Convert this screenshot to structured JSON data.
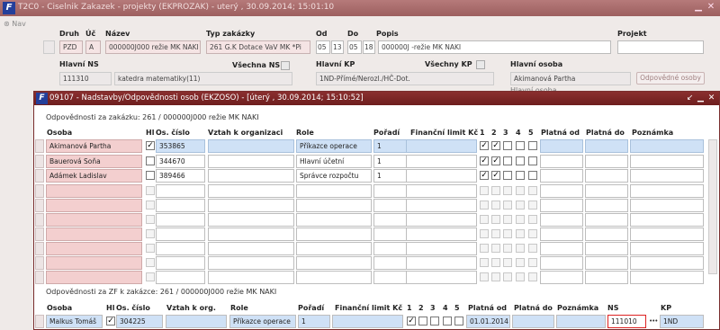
{
  "back_window": {
    "title": "T2C0 - Ciselnik Zakazek - projekty (EKPROZAK) - uterý , 30.09.2014; 15:01:10",
    "logo": "F",
    "nav_label": "Nav",
    "labels": {
      "druh": "Druh",
      "uc": "Úč",
      "nazev": "Název",
      "typ": "Typ zakázky",
      "od": "Od",
      "do": "Do",
      "popis": "Popis",
      "projekt": "Projekt",
      "hlavni_ns": "Hlavní NS",
      "vsechna_ns": "Všechna NS",
      "hlavni_kp": "Hlavní KP",
      "vsechny_kp": "Všechny KP",
      "hlavni_osoba": "Hlavní osoba"
    },
    "values": {
      "druh": "PZD",
      "uc": "A",
      "nazev": "000000J000 režie MK NAKI",
      "typ": "261 G.K Dotace VaV MK *Pi",
      "od_1": "05",
      "od_2": "13",
      "do_1": "05",
      "do_2": "18",
      "popis": "000000J -režie MK NAKI",
      "projekt": "",
      "ns_code": "111310",
      "ns_name": "katedra matematiky(11)",
      "kp": "1ND-Přímé/Nerozl./HČ-Dot.",
      "osoba": "Akimanová Partha"
    },
    "btn_odpovedne": "Odpovědné osoby",
    "cut_label": "Hlavní osoba"
  },
  "front_window": {
    "title": "09107 - Nadstavby/Odpovědnosti osob (EKZOSO) - [úterý , 30.09.2014; 15:10:52]",
    "logo": "F",
    "section1": "Odpovědnosti za zakázku: 261 / 000000J000 režie MK NAKI",
    "headers1": {
      "osoba": "Osoba",
      "hl": "Hl",
      "os_cislo": "Os. číslo",
      "vztah": "Vztah k organizaci",
      "role": "Role",
      "poradi": "Pořadí",
      "limit": "Finanční limit Kč",
      "c1": "1",
      "c2": "2",
      "c3": "3",
      "c4": "4",
      "c5": "5",
      "platna_od": "Platná od",
      "platna_do": "Platná do",
      "poznamka": "Poznámka"
    },
    "rows1": [
      {
        "osoba": "Akimanová Partha",
        "hl": true,
        "os_cislo": "353865",
        "vztah": "",
        "role": "Příkazce operace",
        "poradi": "1",
        "c1": true,
        "c2": true,
        "c3": false,
        "c4": false,
        "c5": false
      },
      {
        "osoba": "Bauerová Soňa",
        "hl": false,
        "os_cislo": "344670",
        "vztah": "",
        "role": "Hlavní účetní",
        "poradi": "1",
        "c1": true,
        "c2": true,
        "c3": false,
        "c4": false,
        "c5": false
      },
      {
        "osoba": "Adámek Ladislav",
        "hl": false,
        "os_cislo": "389466",
        "vztah": "",
        "role": "Správce rozpočtu",
        "poradi": "1",
        "c1": true,
        "c2": true,
        "c3": false,
        "c4": false,
        "c5": false
      }
    ],
    "section2": "Odpovědnosti za ZF k zakázce: 261 / 000000J000 režie MK NAKI",
    "headers2": {
      "osoba": "Osoba",
      "hl": "Hl",
      "os_cislo": "Os. číslo",
      "vztah": "Vztah k org.",
      "role": "Role",
      "poradi": "Pořadí",
      "limit": "Finanční limit Kč",
      "c1": "1",
      "c2": "2",
      "c3": "3",
      "c4": "4",
      "c5": "5",
      "platna_od": "Platná od",
      "platna_do": "Platná do",
      "poznamka": "Poznámka",
      "ns": "NS",
      "kp": "KP"
    },
    "rows2": [
      {
        "osoba": "Malkus Tomáš",
        "hl": true,
        "os_cislo": "304225",
        "vztah": "",
        "role": "Příkazce operace",
        "poradi": "1",
        "c1": true,
        "platna_od": "01.01.2014",
        "ns": "111010",
        "kp": "1ND"
      }
    ]
  }
}
